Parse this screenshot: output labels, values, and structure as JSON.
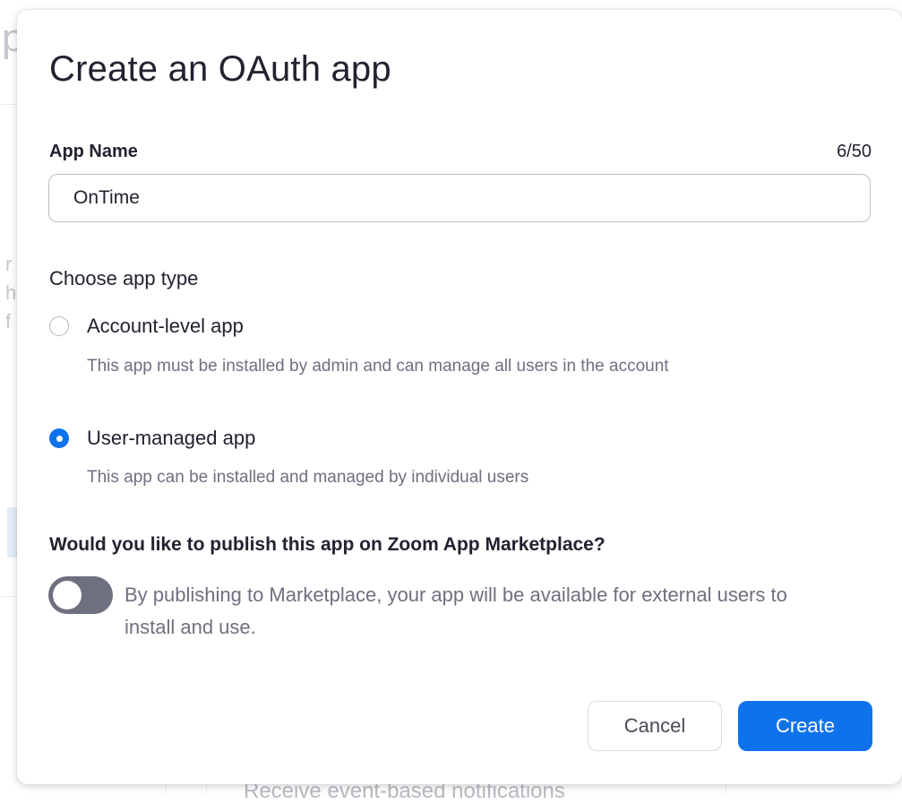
{
  "background": {
    "fragments": [
      "p",
      "r",
      "h",
      "f",
      "Receive event-based notifications"
    ]
  },
  "dialog": {
    "title": "Create an OAuth app",
    "app_name": {
      "label": "App Name",
      "counter": "6/50",
      "value": "OnTime"
    },
    "app_type": {
      "label": "Choose app type",
      "options": [
        {
          "label": "Account-level app",
          "description": "This app must be installed by admin and can manage all users in the account",
          "selected": false
        },
        {
          "label": "User-managed app",
          "description": "This app can be installed and managed by individual users",
          "selected": true
        }
      ]
    },
    "publish": {
      "question": "Would you like to publish this app on Zoom App Marketplace?",
      "enabled": false,
      "description": "By publishing to Marketplace, your app will be available for external users to install and use."
    },
    "buttons": {
      "cancel": "Cancel",
      "create": "Create"
    }
  },
  "colors": {
    "accent": "#0e72ed",
    "toggle_off": "#6e7080",
    "text": "#222230",
    "muted_text": "#6e7080"
  }
}
